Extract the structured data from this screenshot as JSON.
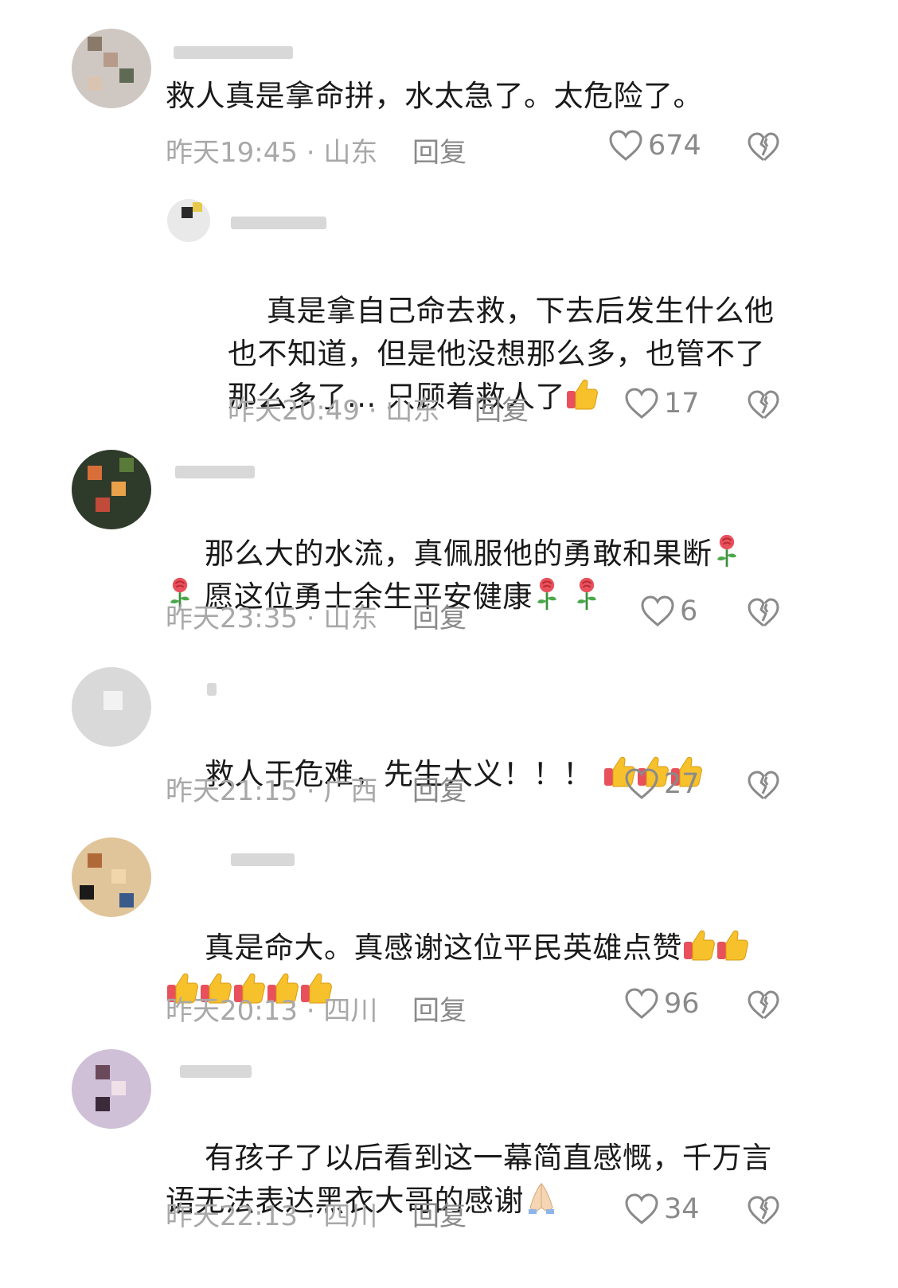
{
  "comments": [
    {
      "text": "救人真是拿命拼，水太急了。太危险了。",
      "time": "昨天19:45 · 山东",
      "reply": "回复",
      "likes": "674"
    },
    {
      "text": "真是拿自己命去救，下去后发生什么他也不知道，但是他没想那么多，也管不了那么多了... 只顾着救人了",
      "time": "昨天20:49 · 山东",
      "reply": "回复",
      "likes": "17"
    },
    {
      "text1": "那么大的水流，真佩服他的勇敢和果断",
      "text2": " 愿这位勇士余生平安健康",
      "time": "昨天23:35 · 山东",
      "reply": "回复",
      "likes": "6"
    },
    {
      "text": "救人于危难，先生大义！！！",
      "time": "昨天21:15 · 广西",
      "reply": "回复",
      "likes": "27"
    },
    {
      "text": "真是命大。真感谢这位平民英雄点赞",
      "time": "昨天20:13 · 四川",
      "reply": "回复",
      "likes": "96"
    },
    {
      "text": "有孩子了以后看到这一幕简直感慨，千万言语无法表达黑衣大哥的感谢",
      "time": "昨天22:13 · 四川",
      "reply": "回复",
      "likes": "34"
    }
  ],
  "icons": {
    "like": "heart-outline-icon",
    "dislike": "broken-heart-icon",
    "thumbs": "thumbs-up-emoji",
    "rose": "rose-emoji",
    "pray": "folded-hands-emoji"
  },
  "colors": {
    "text": "#1a1a1a",
    "meta": "#a8a8a8",
    "icon": "#8a8a8a"
  }
}
